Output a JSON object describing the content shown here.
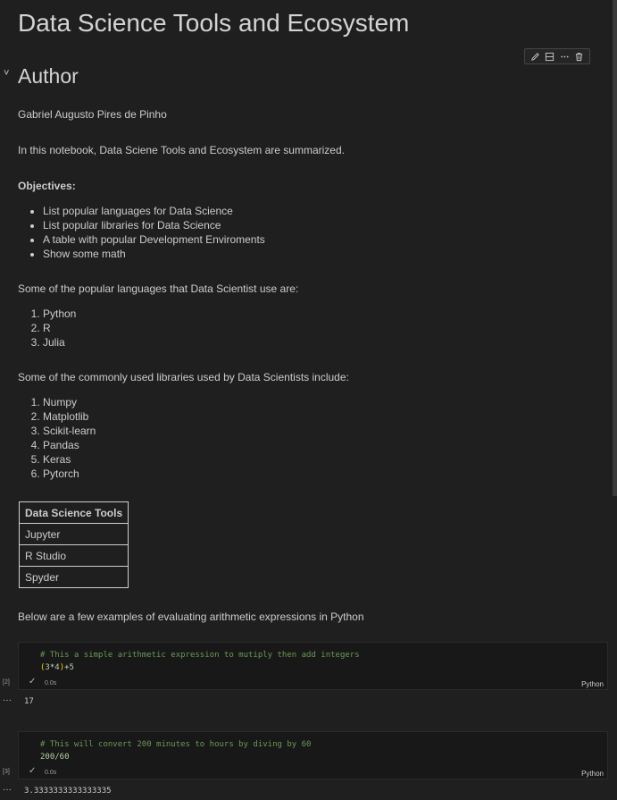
{
  "title": "Data Science Tools and Ecosystem",
  "author_heading": "Author",
  "author_name": "Gabriel Augusto Pires de Pinho",
  "intro": "In this notebook, Data Sciene Tools and Ecosystem are summarized.",
  "objectives_label": "Objectives:",
  "objectives": [
    "List popular languages for Data Science",
    "List popular libraries for Data Science",
    "A table with popular Development Enviroments",
    "Show some math"
  ],
  "languages_intro": "Some of the popular languages that Data Scientist use are:",
  "languages": [
    "Python",
    "R",
    "Julia"
  ],
  "libraries_intro": "Some of the commonly used libraries used by Data Scientists include:",
  "libraries": [
    "Numpy",
    "Matplotlib",
    "Scikit-learn",
    "Pandas",
    "Keras",
    "Pytorch"
  ],
  "tools_table": {
    "header": "Data Science Tools",
    "rows": [
      "Jupyter",
      "R Studio",
      "Spyder"
    ]
  },
  "arith_intro": "Below are a few examples of evaluating arithmetic expressions in Python",
  "cells": [
    {
      "exec_count": "[2]",
      "comment": "# This a simple arithmetic expression to mutiply then add integers",
      "code": {
        "p1": "(",
        "a": "3",
        "op": "*",
        "b": "4",
        "p2": ")",
        "plus": "+",
        "c": "5"
      },
      "time": "0.0s",
      "language": "Python",
      "output_marker": "···",
      "output": "17"
    },
    {
      "exec_count": "[3]",
      "comment": "# This will convert 200 minutes to hours by diving by 60",
      "code_text": "200/60",
      "time": "0.0s",
      "language": "Python",
      "output_marker": "···",
      "output": "3.3333333333333335"
    }
  ],
  "icons": {
    "edit": "pencil-icon",
    "split": "split-cell-icon",
    "more": "ellipsis-icon",
    "delete": "trash-icon",
    "collapse": "chevron-down-icon",
    "success": "check-icon"
  },
  "check_glyph": "✓",
  "chevron_glyph": "˅",
  "colors": {
    "background": "#1f1f1f",
    "code_bg": "#181818",
    "comment": "#6a9955",
    "success": "#89d185"
  }
}
